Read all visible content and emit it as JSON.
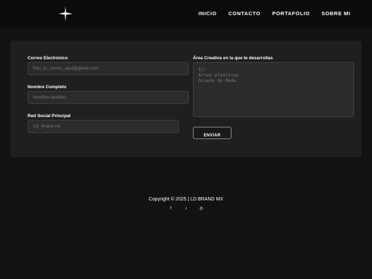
{
  "nav": {
    "items": [
      "INICIO",
      "CONTACTO",
      "PORTAFOLIO",
      "SOBRE MI"
    ]
  },
  "form": {
    "email_label": "Correo Electrónico",
    "email_placeholder": "Pon_tu_correo_aqui@gmail.com",
    "name_label": "Nombre Completo",
    "name_placeholder": "Nombre Apellido",
    "social_label": "Red Social Principal",
    "social_placeholder": "LD_Brand.mx",
    "area_label": "Área Creativa en la que te desarrollas",
    "area_placeholder": "Ej:\nArtes plásticas\nDiseño de Moda",
    "submit_label": "ENVIAR"
  },
  "footer": {
    "copyright": "Copyright © 2025 | LD BRAND MX",
    "social_icons": [
      "facebook-icon",
      "tiktok-icon",
      "instagram-icon"
    ]
  }
}
